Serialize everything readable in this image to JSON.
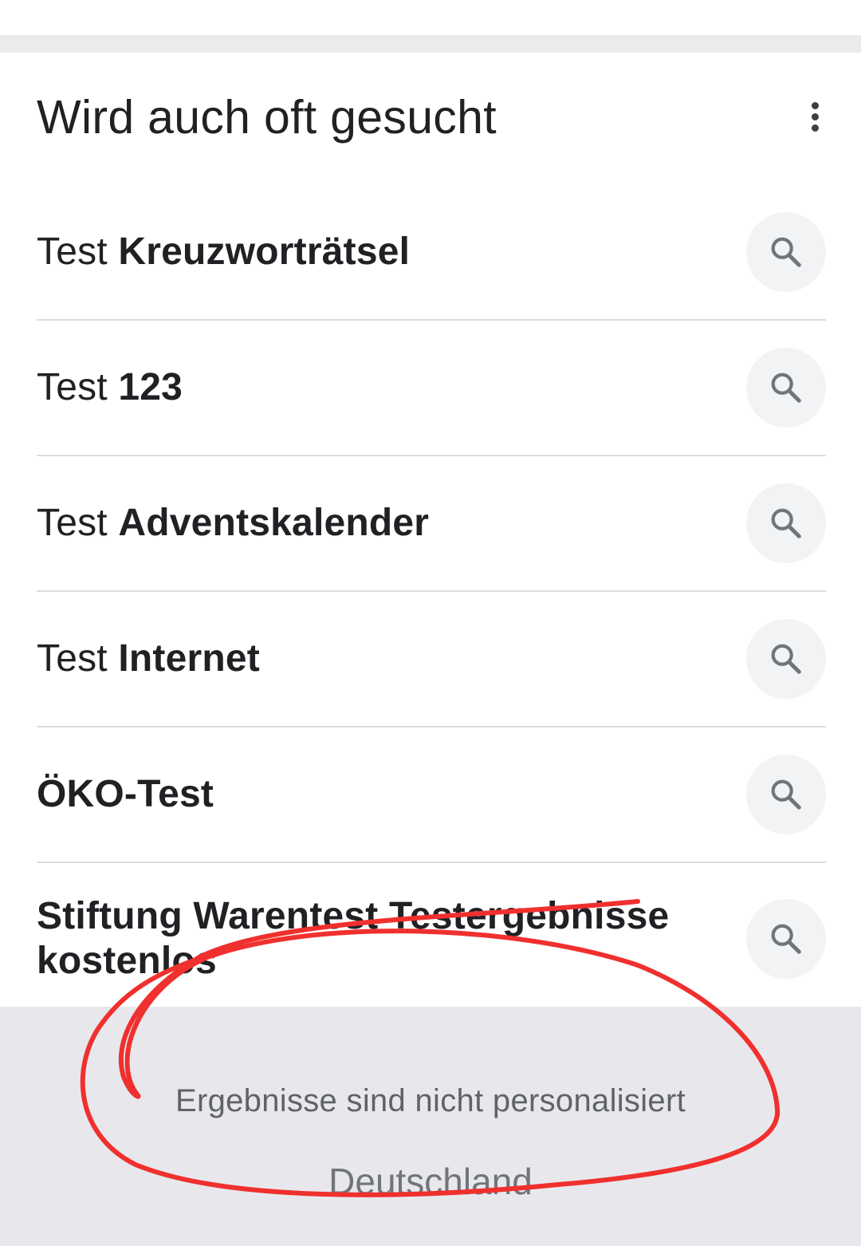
{
  "section": {
    "title": "Wird auch oft gesucht",
    "more_icon": "more-vert-icon"
  },
  "results": [
    {
      "prefix": "Test ",
      "bold": "Kreuzworträtsel",
      "icon": "search-icon"
    },
    {
      "prefix": "Test ",
      "bold": "123",
      "icon": "search-icon"
    },
    {
      "prefix": "Test ",
      "bold": "Adventskalender",
      "icon": "search-icon"
    },
    {
      "prefix": "Test ",
      "bold": "Internet",
      "icon": "search-icon"
    },
    {
      "prefix": "",
      "bold": "ÖKO-Test",
      "icon": "search-icon"
    },
    {
      "prefix": "",
      "bold": "Stiftung Warentest Testergebnisse kostenlos",
      "icon": "search-icon"
    }
  ],
  "footer": {
    "note": "Ergebnisse sind nicht personalisiert",
    "country": "Deutschland"
  },
  "colors": {
    "annotation_stroke": "#f0302e",
    "footer_background": "#e8e8ec",
    "search_circle": "#f1f3f4"
  }
}
